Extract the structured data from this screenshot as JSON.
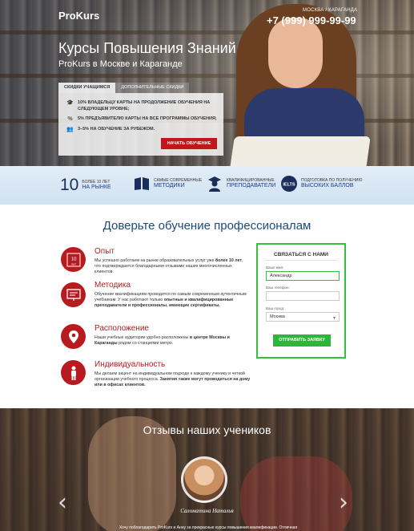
{
  "header": {
    "logo": "ProKurs",
    "location": "МОСКВА / КАРАГАНДА",
    "phone": "+7 (999) 999-99-99"
  },
  "hero": {
    "title": "Курсы Повышения Знаний",
    "subtitle": "ProKurs в Москве и Караганде",
    "tabs": [
      {
        "label": "СКИДКИ УЧАЩИМСЯ",
        "active": true
      },
      {
        "label": "ДОПОЛНИТЕЛЬНЫЕ СКИДКИ",
        "active": false
      }
    ],
    "discounts": [
      {
        "icon": "graduation-cap-icon",
        "text_line1": "10% ВЛАДЕЛЬЦУ КАРТЫ НА ПРОДОЛЖЕНИЕ ОБУЧЕНИЯ НА",
        "text_line2": "СЛЕДУЮЩЕМ УРОВНЕ;"
      },
      {
        "icon": "percent-icon",
        "text_line1": "5% ПРЕДЪЯВИТЕЛЮ КАРТЫ НА ВСЕ ПРОГРАММЫ ОБУЧЕНИЯ;",
        "text_line2": ""
      },
      {
        "icon": "people-icon",
        "text_line1": "3–5% НА ОБУЧЕНИЕ ЗА РУБЕЖОМ.",
        "text_line2": ""
      }
    ],
    "cta_label": "НАЧАТЬ ОБУЧЕНИЕ"
  },
  "stats": [
    {
      "big": "10",
      "small": "БОЛЕЕ 10 ЛЕТ",
      "strong": "НА РЫНКЕ",
      "icon": ""
    },
    {
      "big": "",
      "small": "САМЫЕ СОВРЕМЕННЫЕ",
      "strong": "МЕТОДИКИ",
      "icon": "book-icon"
    },
    {
      "big": "",
      "small": "КВАЛИФИЦИРОВАННЫЕ",
      "strong": "ПРЕПОДАВАТЕЛИ",
      "icon": "teacher-icon"
    },
    {
      "big": "",
      "small": "ПОДГОТОВКА ПО ПОЛУЧЕНИЮ",
      "strong": "ВЫСОКИХ БАЛЛОВ",
      "icon": "ielts-icon",
      "icon_text": "IELTS"
    }
  ],
  "main": {
    "title": "Доверьте обучение профессионалам",
    "features": [
      {
        "title": "Опыт",
        "icon": "ten-years-icon",
        "icon_text": "10",
        "icon_sub": "лет",
        "text": "Мы успешно работаем на рынке образовательных услуг уже ",
        "bold": "более 10 лет",
        "text2": ", что подтверждается благодарными отзывами наших многочисленных клиентов."
      },
      {
        "title": "Методика",
        "icon": "presentation-board-icon",
        "text": "Обучение квалификациям проводится по самым современным аутентичным учебникам. У нас работают только ",
        "bold": "опытные и квалифицированные преподаватели и профессионалы, имеющие сертификаты.",
        "text2": ""
      },
      {
        "title": "Расположение",
        "icon": "map-pin-icon",
        "text": "Наши учебные аудитории удобно расположены ",
        "bold": "в центре Москвы и Караганды",
        "text2": " рядом со станциями метро."
      },
      {
        "title": "Индивидуальность",
        "icon": "person-icon",
        "text": "Мы делаем акцент на индивидуальном подходе к каждому ученику и четкой организации учебного процесса. ",
        "bold": "Занятия также могут проводиться на дому или в офисах клиентов.",
        "text2": ""
      }
    ]
  },
  "contact_form": {
    "title": "СВЯЗАТЬСЯ С НАМИ",
    "name_label": "Ваше имя:",
    "name_value": "Александр",
    "phone_label": "Ваш телефон:",
    "phone_value": "",
    "city_label": "Ваш город:",
    "city_value": "Москва",
    "submit_label": "ОТПРАВИТЬ ЗАЯВКУ"
  },
  "reviews": {
    "title": "Отзывы наших учеников",
    "reviewer_name": "Саломатина Наталья",
    "text": "Хочу поблагодарить ProKurs и Анну за прекрасные курсы повышения квалификации. Отличная"
  }
}
